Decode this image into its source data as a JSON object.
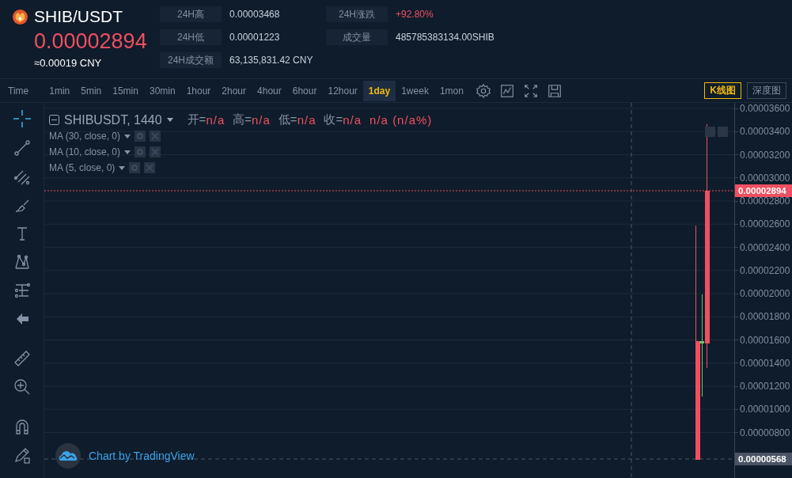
{
  "header": {
    "symbol": "SHIB/USDT",
    "price": "0.00002894",
    "cny": "≈0.00019 CNY",
    "stats": [
      {
        "label": "24H高",
        "value": "0.00003468",
        "color": "#c8d2de"
      },
      {
        "label": "24H涨跌",
        "value": "+92.80%",
        "color": "#ef4f60"
      },
      {
        "label": "24H低",
        "value": "0.00001223",
        "color": "#c8d2de"
      },
      {
        "label": "成交量",
        "value": "485785383134.00SHIB",
        "color": "#c8d2de"
      },
      {
        "label": "24H成交额",
        "value": "63,135,831.42 CNY",
        "color": "#c8d2de"
      }
    ]
  },
  "toolbar": {
    "intervals": [
      {
        "label": "Time",
        "selected": false
      },
      {
        "label": "1min",
        "selected": false
      },
      {
        "label": "5min",
        "selected": false
      },
      {
        "label": "15min",
        "selected": false
      },
      {
        "label": "30min",
        "selected": false
      },
      {
        "label": "1hour",
        "selected": false
      },
      {
        "label": "2hour",
        "selected": false
      },
      {
        "label": "4hour",
        "selected": false
      },
      {
        "label": "6hour",
        "selected": false
      },
      {
        "label": "12hour",
        "selected": false
      },
      {
        "label": "1day",
        "selected": true
      },
      {
        "label": "1week",
        "selected": false
      },
      {
        "label": "1mon",
        "selected": false
      }
    ],
    "view_modes": [
      {
        "label": "K线图",
        "selected": true
      },
      {
        "label": "深度图",
        "selected": false
      }
    ]
  },
  "chart": {
    "legend": {
      "symbol": "SHIBUSDT, 1440",
      "ohlc": [
        {
          "label": "开=",
          "value": "n/a"
        },
        {
          "label": "高=",
          "value": "n/a"
        },
        {
          "label": "低=",
          "value": "n/a"
        },
        {
          "label": "收=",
          "value": "n/a"
        }
      ],
      "change": "n/a (n/a%)"
    },
    "indicators": [
      "MA (30, close, 0)",
      "MA (10, close, 0)",
      "MA (5, close, 0)"
    ],
    "price_axis": [
      "0.00003600",
      "0.00003400",
      "0.00003200",
      "0.00003000",
      "0.00002800",
      "0.00002600",
      "0.00002400",
      "0.00002200",
      "0.00002000",
      "0.00001800",
      "0.00001600",
      "0.00001400",
      "0.00001200",
      "0.00001000",
      "0.00000800"
    ],
    "last_price": "0.00002894",
    "crosshair_price": "0.00000568",
    "attribution": "Chart by TradingView"
  }
}
